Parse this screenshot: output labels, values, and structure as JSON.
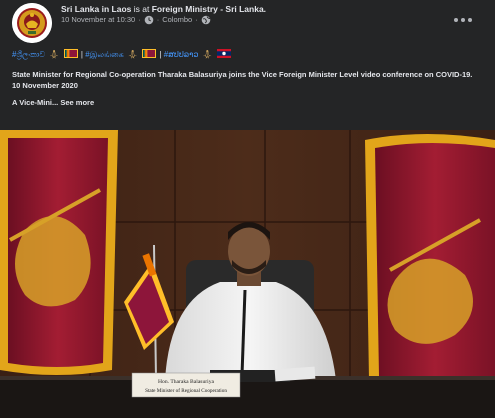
{
  "post": {
    "author": "Sri Lanka in Laos",
    "is_at_text": "is at",
    "location": "Foreign Ministry - Sri Lanka.",
    "timestamp": "10 November at 10:30",
    "place": "Colombo",
    "dot": "·",
    "hashtag_si": "#ශ්‍රීලංකාව",
    "hashtag_ta": "#இலங்கை",
    "hashtag_lo": "#ສປປລາວ",
    "separator": "|",
    "headline": "State Minister for Regional Co-operation Tharaka Balasuriya joins the Vice Foreign Minister Level video conference on COVID-19.",
    "date": "10 November 2020",
    "excerpt": "A Vice-Mini...",
    "see_more": "See more"
  },
  "photo": {
    "nameplate_line1": "Hon. Tharaka Balasuriya",
    "nameplate_line2": "State Minister of Regional Cooperation"
  },
  "icons": {
    "avatar": "sri-lanka-emblem",
    "clock": "clock-icon",
    "globe": "globe-icon",
    "more": "more-options-icon"
  },
  "colors": {
    "background": "#242526",
    "link": "#4599ff",
    "text": "#e4e6eb",
    "secondary": "#b0b3b8",
    "flag_maroon": "#8d153a",
    "flag_gold": "#ffbe29"
  }
}
